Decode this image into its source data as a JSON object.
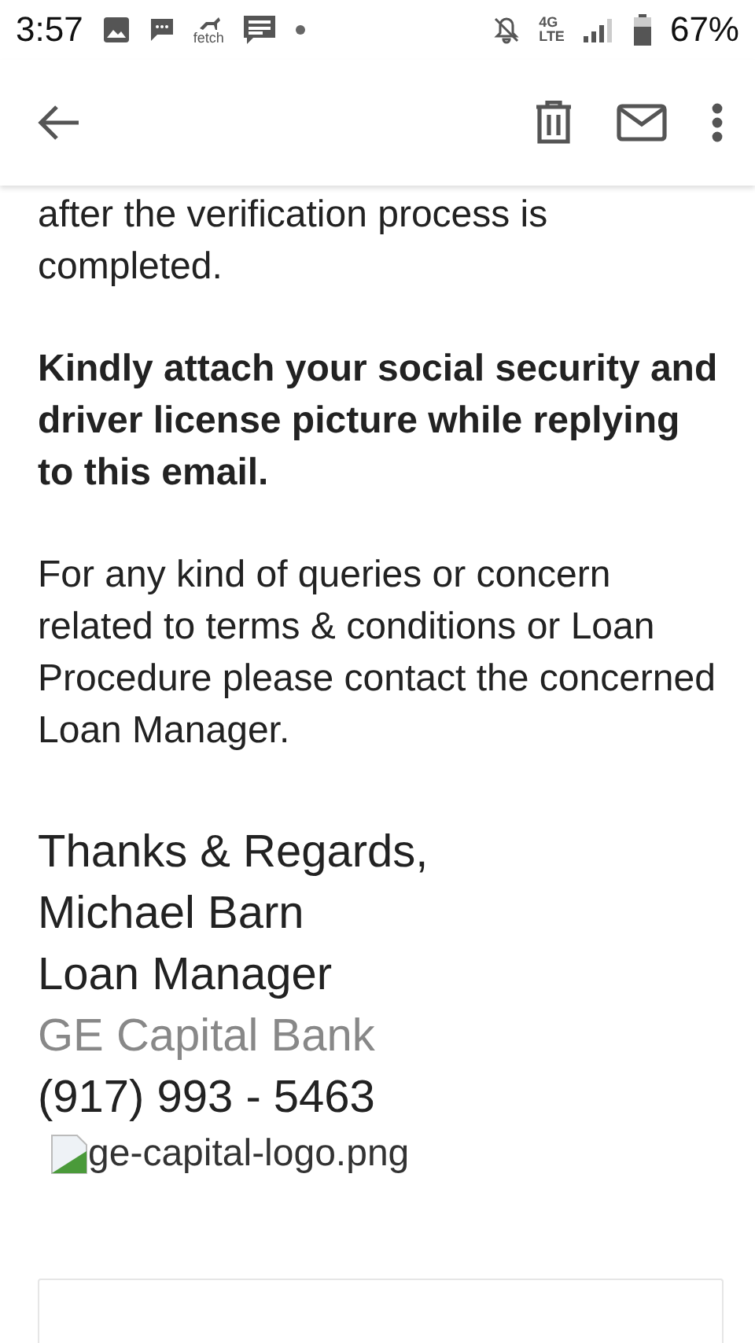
{
  "status_bar": {
    "time": "3:57",
    "app_label": "fetch",
    "network": [
      "4G",
      "LTE"
    ],
    "battery": "67%"
  },
  "email": {
    "paragraphs": [
      {
        "text": "after the verification process is completed.",
        "bold": false
      },
      {
        "text": "Kindly attach your social security and driver license picture while replying to this email.",
        "bold": true
      },
      {
        "text": "For any kind of queries or concern related to terms & conditions or Loan Procedure please contact the concerned Loan Manager.",
        "bold": false
      }
    ],
    "signature": [
      {
        "text": "Thanks & Regards,",
        "kind": "plain"
      },
      {
        "text": "Michael Barn",
        "kind": "plain"
      },
      {
        "text": "Loan Manager",
        "kind": "plain"
      },
      {
        "text": "GE Capital Bank",
        "kind": "muted"
      },
      {
        "text": "(917) 993 - 5463",
        "kind": "plain"
      }
    ],
    "broken_image": "ge-capital-logo.png"
  }
}
